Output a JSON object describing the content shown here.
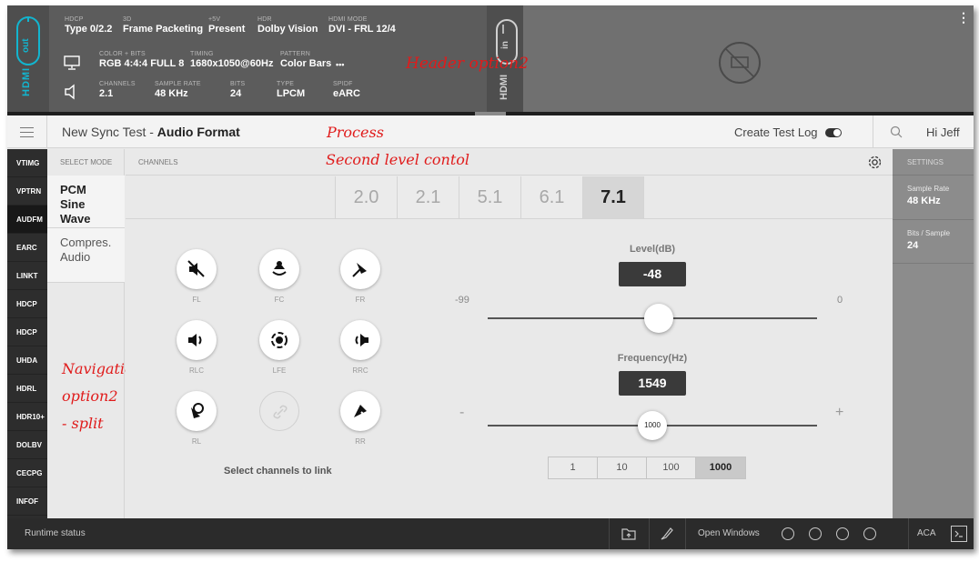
{
  "header": {
    "row1": [
      {
        "label": "HDCP",
        "value": "Type 0/2.2"
      },
      {
        "label": "3D",
        "value": "Frame Packeting"
      },
      {
        "label": "+5V",
        "value": "Present"
      },
      {
        "label": "HDR",
        "value": "Dolby Vision"
      },
      {
        "label": "HDMI MODE",
        "value": "DVI - FRL 12/4"
      }
    ],
    "row2": [
      {
        "label": "COLOR + BITS",
        "value": "RGB 4:4:4 FULL 8"
      },
      {
        "label": "TIMING",
        "value": "1680x1050@60Hz"
      },
      {
        "label": "PATTERN",
        "value": "Color Bars"
      }
    ],
    "row2_more": "•••",
    "row3": [
      {
        "label": "CHANNELS",
        "value": "2.1"
      },
      {
        "label": "SAMPLE RATE",
        "value": "48 KHz"
      },
      {
        "label": "BITS",
        "value": "24"
      },
      {
        "label": "Type",
        "value": "LPCM"
      },
      {
        "label": "SPIDF",
        "value": "eARC"
      }
    ],
    "hdmi_out_label": "HDMI",
    "hdmi_out_badge": "out",
    "hdmi_in_label": "HDMI",
    "hdmi_in_badge": "in",
    "menu_glyph": "⋮",
    "accent_color": "#12b5cf"
  },
  "annotations": {
    "header_option": "Header option2",
    "process": "Process",
    "second_level": "Second level contol",
    "navigation_1": "Navigation:",
    "navigation_2": "option2",
    "navigation_3": "- split"
  },
  "titlebar": {
    "title_prefix": "New Sync Test - ",
    "title_main": "Audio Format",
    "create_log": "Create Test Log",
    "create_log_on": true,
    "greeting": "Hi Jeff"
  },
  "nav": {
    "items": [
      "VTIMG",
      "VPTRN",
      "AUDFM",
      "EARC",
      "LINKT",
      "HDCP",
      "HDCP",
      "UHDA",
      "HDRL",
      "HDR10+",
      "DOLBV",
      "CECPG",
      "INFOF"
    ],
    "active_index": 2
  },
  "modes": {
    "header": "SELECT MODE",
    "items": [
      "PCM Sine Wave",
      "Compres. Audio"
    ],
    "active_index": 0
  },
  "channels": {
    "header": "CHANNELS",
    "tabs": [
      "2.0",
      "2.1",
      "5.1",
      "6.1",
      "7.1"
    ],
    "selected": "7.1",
    "speakers": [
      {
        "label": "FL",
        "enabled": true
      },
      {
        "label": "FC",
        "enabled": true
      },
      {
        "label": "FR",
        "enabled": true
      },
      {
        "label": "RLC",
        "enabled": true
      },
      {
        "label": "LFE",
        "enabled": true
      },
      {
        "label": "RRC",
        "enabled": true
      },
      {
        "label": "RL",
        "enabled": true
      },
      {
        "label": "",
        "enabled": false
      },
      {
        "label": "RR",
        "enabled": true
      }
    ],
    "select_link": "Select channels to link"
  },
  "level": {
    "title": "Level(dB)",
    "value": "-48",
    "min_label": "-99",
    "max_label": "0",
    "position": 0.52
  },
  "frequency": {
    "title": "Frequency(Hz)",
    "value": "1549",
    "min_label": "-",
    "max_label": "+",
    "knob_label": "1000",
    "position": 0.5,
    "steps": [
      "1",
      "10",
      "100",
      "1000"
    ],
    "selected_step": "1000"
  },
  "settings": {
    "header": "SETTINGS",
    "items": [
      {
        "label": "Sample Rate",
        "value": "48 KHz"
      },
      {
        "label": "Bits / Sample",
        "value": "24"
      }
    ]
  },
  "statusbar": {
    "runtime": "Runtime status",
    "open_windows": "Open Windows",
    "window_count": 4,
    "aca": "ACA"
  }
}
